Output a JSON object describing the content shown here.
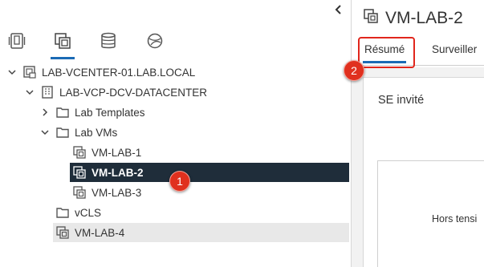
{
  "navigator": {
    "collapse_icon": "chevron-left-icon",
    "tabs": [
      {
        "icon": "hosts-clusters-icon",
        "active": false
      },
      {
        "icon": "vms-templates-icon",
        "active": true
      },
      {
        "icon": "storage-icon",
        "active": false
      },
      {
        "icon": "networking-icon",
        "active": false
      }
    ],
    "tree": {
      "vcenter": "LAB-VCENTER-01.LAB.LOCAL",
      "datacenter": "LAB-VCP-DCV-DATACENTER",
      "folder_templates": "Lab Templates",
      "folder_vms": "Lab VMs",
      "vm1": "VM-LAB-1",
      "vm2": "VM-LAB-2",
      "vm3": "VM-LAB-3",
      "folder_vcls": "vCLS",
      "vm4": "VM-LAB-4"
    }
  },
  "object": {
    "title": "VM-LAB-2",
    "tabs": [
      "Résumé",
      "Surveiller"
    ],
    "active_tab": "Résumé"
  },
  "summary": {
    "card_title": "SE invité",
    "status_text": "Hors tensi"
  },
  "callouts": {
    "badge_1": "1",
    "badge_2": "2"
  },
  "colors": {
    "selected_row": "#1f2d3a",
    "accent": "#1b6bb5",
    "callout": "#e0301e"
  }
}
